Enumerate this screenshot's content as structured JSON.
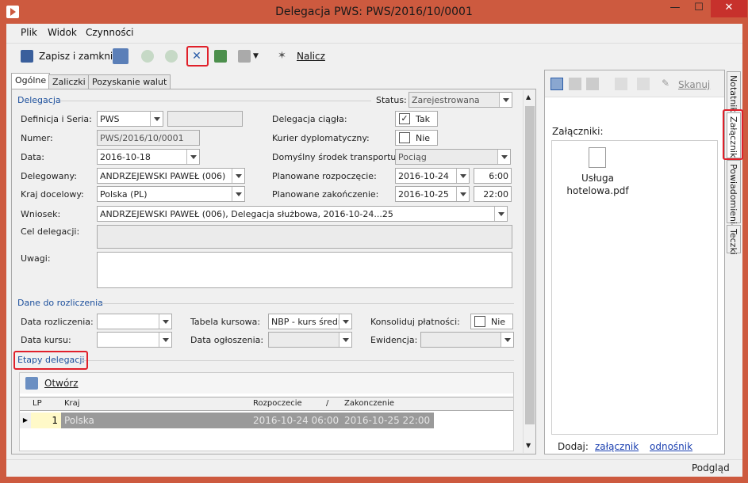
{
  "window": {
    "title": "Delegacja PWS: PWS/2016/10/0001",
    "min": "—",
    "max": "☐",
    "close": "✕"
  },
  "menu": [
    "Plik",
    "Widok",
    "Czynności"
  ],
  "toolbar": {
    "save_close": "Zapisz i zamknij",
    "calculate": "Nalicz"
  },
  "tabs": [
    "Ogólne",
    "Zaliczki",
    "Pozyskanie walut"
  ],
  "delegacja": {
    "section": "Delegacja",
    "status_label": "Status:",
    "status": "Zarejestrowana",
    "def_label": "Definicja i Seria:",
    "def": "PWS",
    "def2": "",
    "num_label": "Numer:",
    "num": "PWS/2016/10/0001",
    "date_label": "Data:",
    "date": "2016-10-18",
    "deleg_label": "Delegowany:",
    "deleg": "ANDRZEJEWSKI PAWEŁ (006)",
    "kraj_label": "Kraj docelowy:",
    "kraj": "Polska (PL)",
    "ciagla_label": "Delegacja ciągła:",
    "ciagla": "Tak",
    "kurier_label": "Kurier dyplomatyczny:",
    "kurier": "Nie",
    "transport_label": "Domyślny środek transportu:",
    "transport": "Pociąg",
    "start_label": "Planowane rozpoczęcie:",
    "start_date": "2016-10-24",
    "start_time": "6:00",
    "end_label": "Planowane zakończenie:",
    "end_date": "2016-10-25",
    "end_time": "22:00",
    "wniosek_label": "Wniosek:",
    "wniosek": "ANDRZEJEWSKI PAWEŁ (006), Delegacja służbowa, 2016-10-24...25",
    "cel_label": "Cel delegacji:",
    "uwagi_label": "Uwagi:"
  },
  "rozliczenie": {
    "section": "Dane do rozliczenia",
    "data_rozl_label": "Data rozliczenia:",
    "data_kursu_label": "Data kursu:",
    "tabela_label": "Tabela kursowa:",
    "tabela": "NBP - kurs średni",
    "ogloszenia_label": "Data ogłoszenia:",
    "konsol_label": "Konsoliduj płatności:",
    "konsol": "Nie",
    "ewid_label": "Ewidencja:"
  },
  "etapy": {
    "section": "Etapy delegacji",
    "open": "Otwórz",
    "columns": [
      "LP",
      "Kraj",
      "Rozpoczecie",
      "/",
      "Zakonczenie"
    ],
    "rows": [
      {
        "lp": "1",
        "kraj": "Polska",
        "start": "2016-10-24 06:00",
        "end": "2016-10-25 22:00"
      }
    ]
  },
  "right": {
    "scan": "Skanuj",
    "attachments_label": "Załączniki:",
    "file_line1": "Usługa",
    "file_line2": "hotelowa.pdf",
    "add_label": "Dodaj:",
    "add_attachment": "załącznik",
    "add_link": "odnośnik"
  },
  "vtabs": [
    "Notatnik",
    "Załączniki",
    "Powiadomienia",
    "Teczki"
  ],
  "statusbar": {
    "preview": "Podgląd"
  },
  "colors": {
    "accent": "#cd5a3f",
    "section": "#1c4f9c",
    "highlight": "#e0202a",
    "link": "#1a3fb0"
  }
}
